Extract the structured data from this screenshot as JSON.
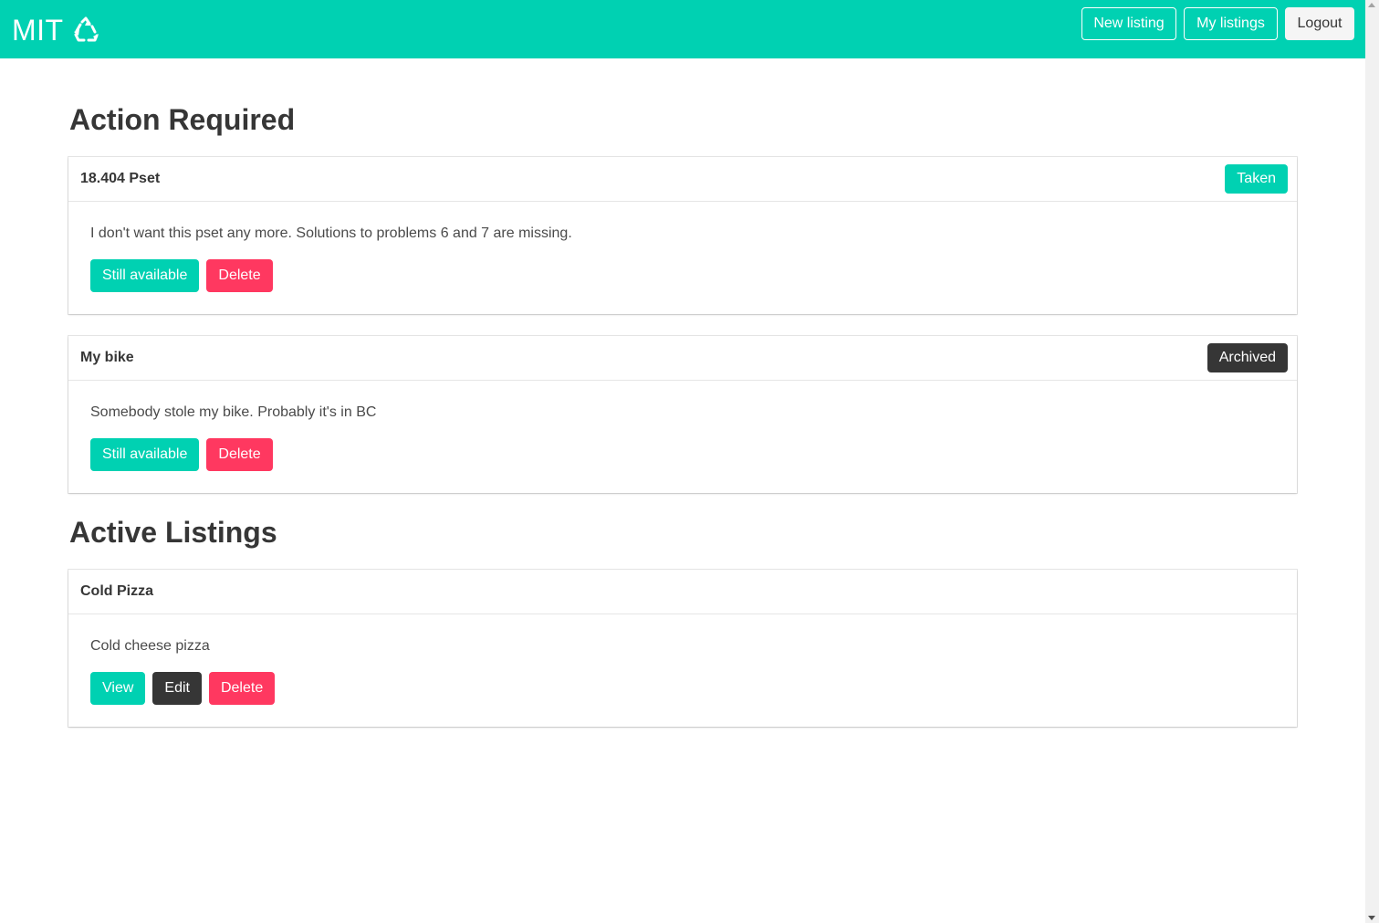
{
  "navbar": {
    "brand_text": "MIT",
    "brand_icon": "recycle-icon",
    "buttons": {
      "new_listing": "New listing",
      "my_listings": "My listings",
      "logout": "Logout"
    },
    "color": "#00d1b2"
  },
  "sections": {
    "action_required": {
      "title": "Action Required",
      "cards": [
        {
          "title": "18.404 Pset",
          "tag": "Taken",
          "text": "I don't want this pset any more. Solutions to problems 6 and 7 are missing.",
          "buttons": {
            "still_available": "Still available",
            "delete": "Delete"
          }
        },
        {
          "title": "My bike",
          "tag": "Archived",
          "text": "Somebody stole my bike. Probably it's in BC",
          "buttons": {
            "still_available": "Still available",
            "delete": "Delete"
          }
        }
      ]
    },
    "active_listings": {
      "title": "Active Listings",
      "cards": [
        {
          "title": "Cold Pizza",
          "text": "Cold cheese pizza",
          "buttons": {
            "view": "View",
            "edit": "Edit",
            "delete": "Delete"
          }
        }
      ]
    }
  },
  "colors": {
    "primary": "#00d1b2",
    "danger": "#ff3860",
    "dark": "#363636"
  }
}
